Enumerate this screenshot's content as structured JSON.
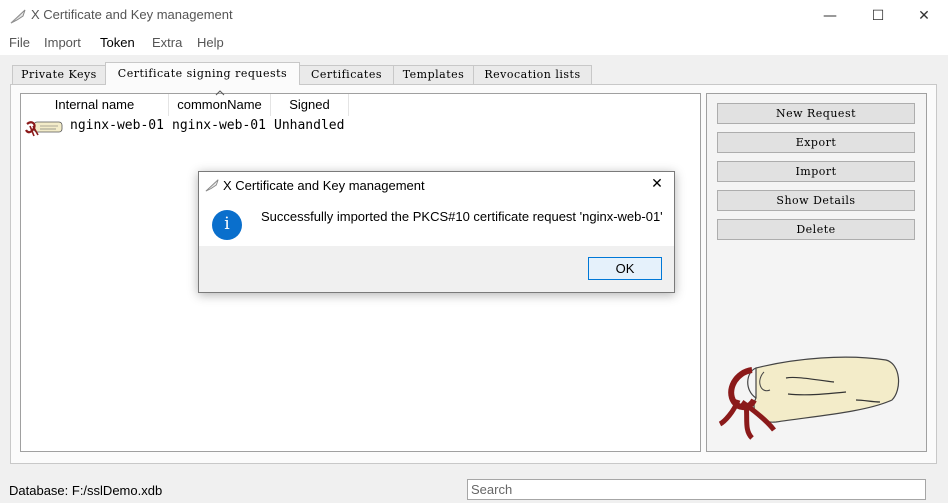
{
  "window": {
    "title": "X Certificate and Key management",
    "minimize": "—",
    "maximize": "☐",
    "close": "✕"
  },
  "menu": [
    {
      "label": "File"
    },
    {
      "label": "Import"
    },
    {
      "label": "Token"
    },
    {
      "label": "Extra"
    },
    {
      "label": "Help"
    }
  ],
  "tabs": [
    {
      "label": "Private Keys"
    },
    {
      "label": "Certificate signing requests"
    },
    {
      "label": "Certificates"
    },
    {
      "label": "Templates"
    },
    {
      "label": "Revocation lists"
    }
  ],
  "table": {
    "columns": [
      "Internal name",
      "commonName",
      "Signed"
    ],
    "rows": [
      {
        "internal_name": "nginx-web-01",
        "common_name": "nginx-web-01",
        "signed": "Unhandled"
      }
    ]
  },
  "actions": {
    "new_request": "New Request",
    "export": "Export",
    "import": "Import",
    "show_details": "Show Details",
    "delete": "Delete"
  },
  "status": {
    "database": "Database: F:/sslDemo.xdb"
  },
  "search": {
    "placeholder": "Search"
  },
  "dialog": {
    "title": "X Certificate and Key management",
    "message": "Successfully imported the PKCS#10 certificate request 'nginx-web-01'",
    "ok_label": "OK",
    "close": "✕",
    "info_glyph": "i"
  },
  "icons": {
    "app": "feather-pen-icon",
    "row": "scroll-icon",
    "logo": "scroll-logo",
    "info": "info-icon"
  },
  "colors": {
    "accent": "#0078d7",
    "info": "#0a6fcc",
    "ribbon": "#8b1a1a",
    "parchment": "#f3ecc9"
  }
}
